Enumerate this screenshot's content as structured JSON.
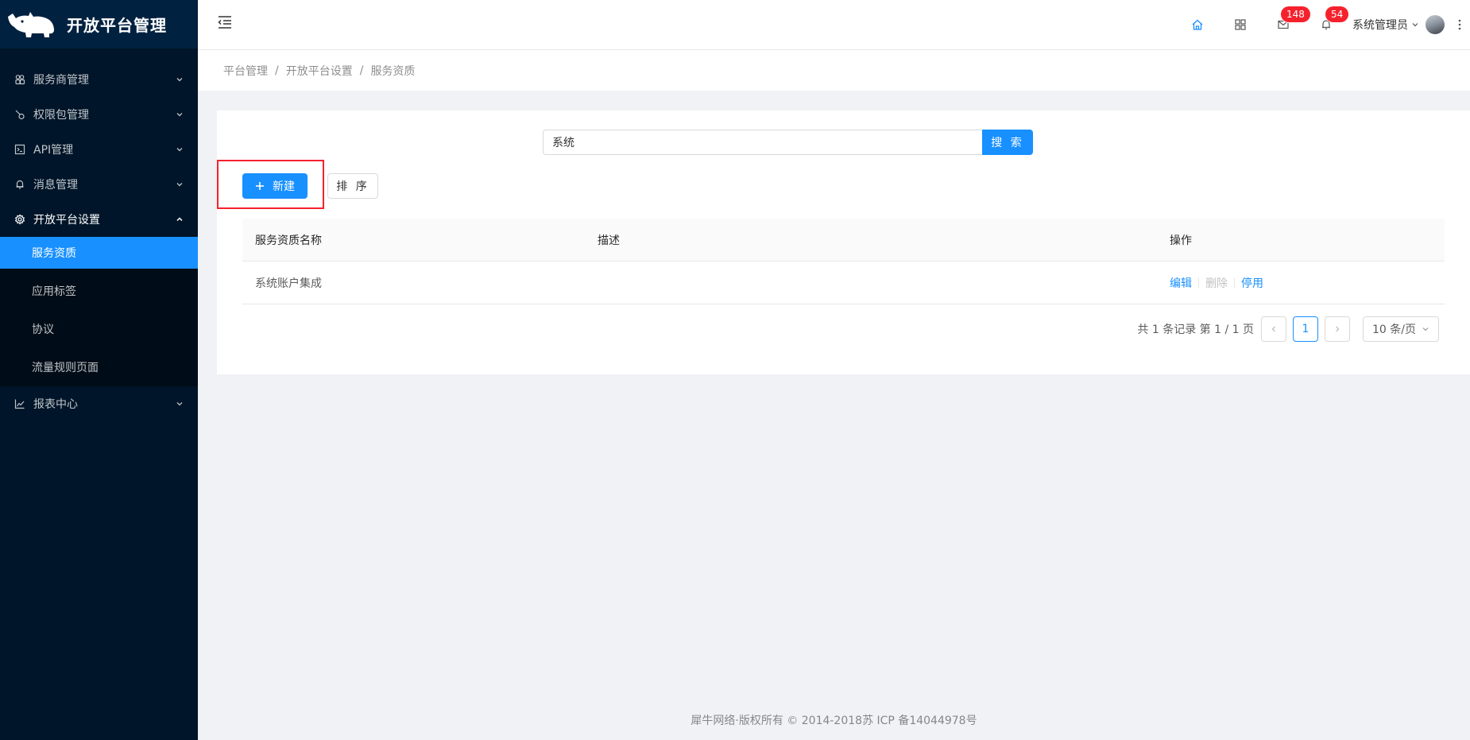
{
  "app": {
    "title": "开放平台管理"
  },
  "sidebar": {
    "menus": [
      {
        "label": "服务商管理",
        "icon": "team-icon",
        "open": false
      },
      {
        "label": "权限包管理",
        "icon": "key-icon",
        "open": false
      },
      {
        "label": "API管理",
        "icon": "code-icon",
        "open": false
      },
      {
        "label": "消息管理",
        "icon": "bell-icon",
        "open": false
      },
      {
        "label": "开放平台设置",
        "icon": "gear-icon",
        "open": true
      },
      {
        "label": "报表中心",
        "icon": "line-chart-icon",
        "open": false
      }
    ],
    "submenu": [
      {
        "label": "服务资质",
        "active": true
      },
      {
        "label": "应用标签",
        "active": false
      },
      {
        "label": "协议",
        "active": false
      },
      {
        "label": "流量规则页面",
        "active": false
      }
    ]
  },
  "header": {
    "mail_badge": "148",
    "notice_badge": "54",
    "user_name": "系统管理员"
  },
  "breadcrumb": [
    "平台管理",
    "开放平台设置",
    "服务资质"
  ],
  "search": {
    "value": "系统",
    "button_label": "搜 索"
  },
  "toolbar": {
    "new_label": "新建",
    "sort_label": "排 序"
  },
  "table": {
    "columns": [
      "服务资质名称",
      "描述",
      "操作"
    ],
    "rows": [
      {
        "name": "系统账户集成",
        "description": "",
        "actions": {
          "edit": "编辑",
          "delete": "删除",
          "disable": "停用"
        }
      }
    ]
  },
  "pagination": {
    "total_text": "共 1 条记录 第 1 / 1 页",
    "current": "1",
    "page_size": "10 条/页"
  },
  "footer": {
    "text": "犀牛网络·版权所有 © 2014-2018苏 ICP 备14044978号"
  },
  "colors": {
    "primary": "#1890ff",
    "sidebar_bg": "#001529",
    "highlight": "#f5222d"
  }
}
